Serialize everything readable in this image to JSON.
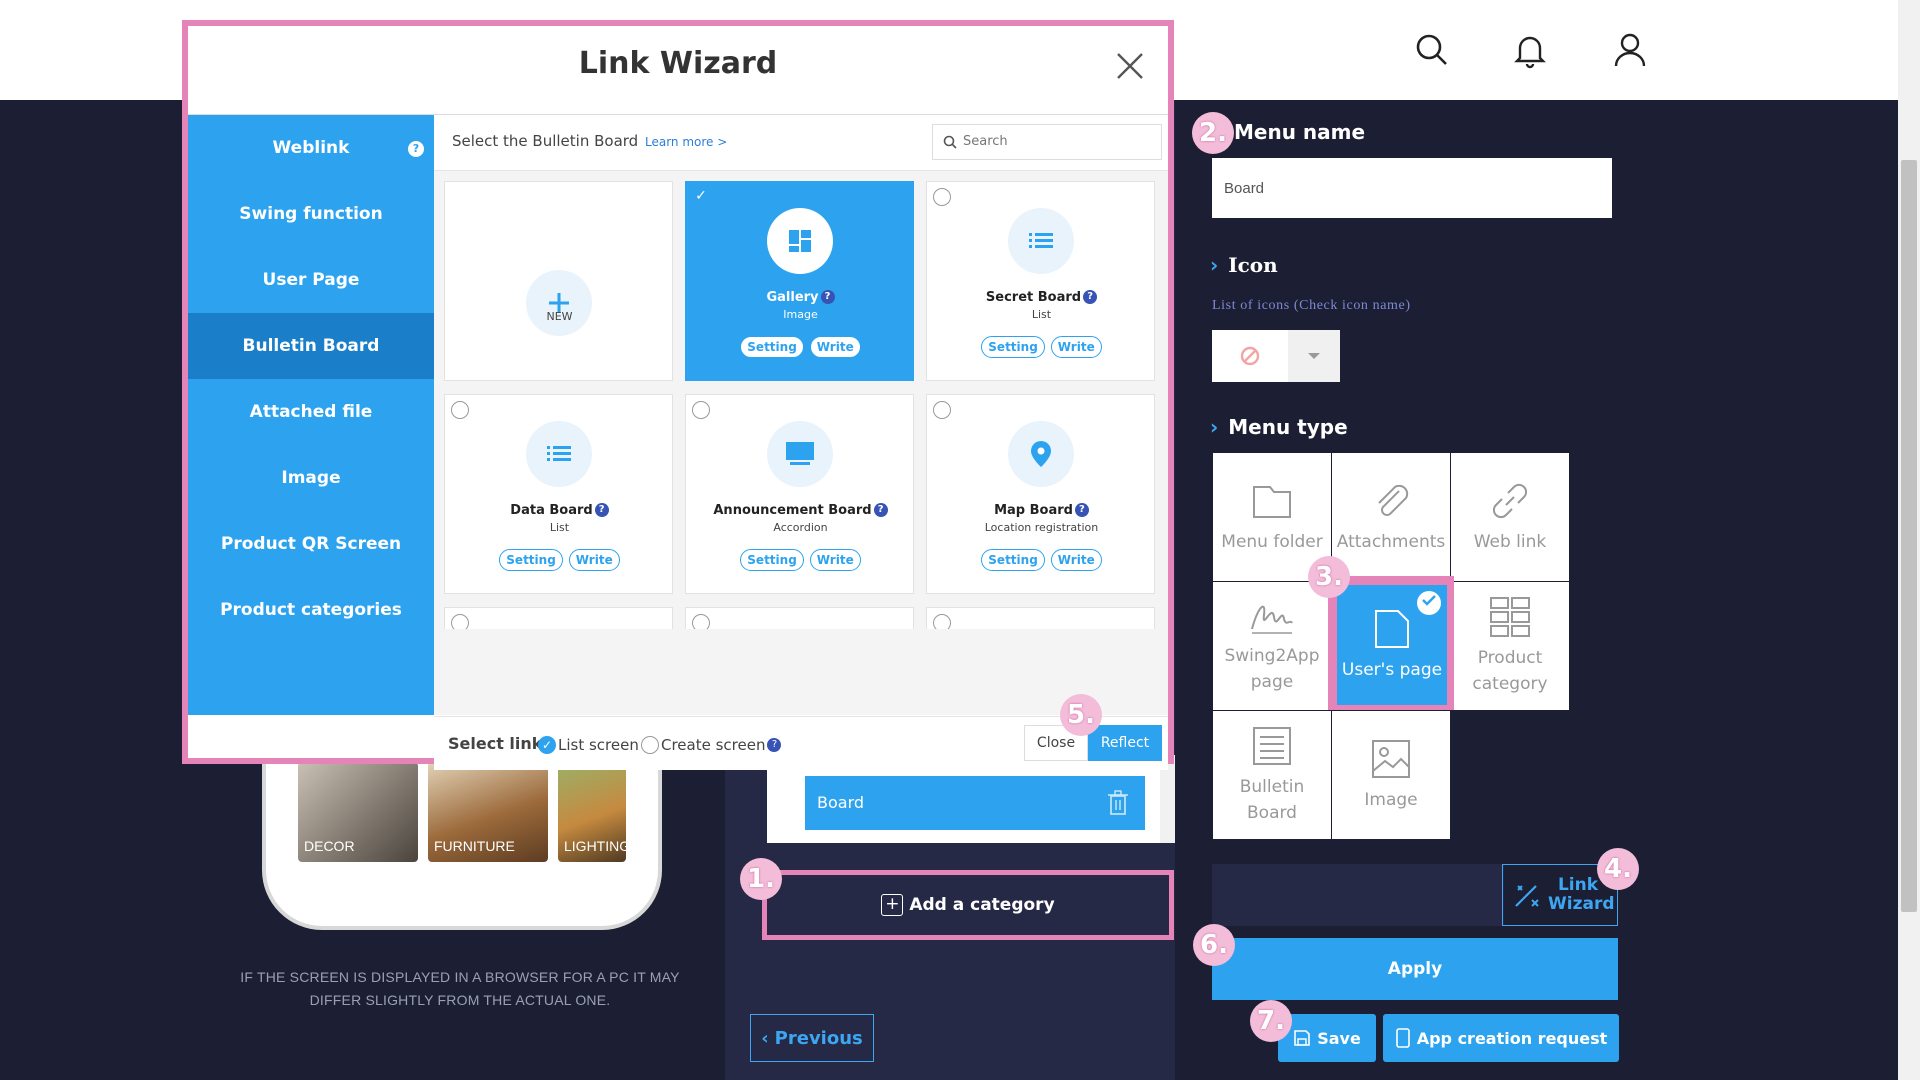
{
  "colors": {
    "accent": "#2da3f0",
    "highlight": "#e584b8",
    "background": "#1c1f33"
  },
  "header": {
    "icons": [
      "search-icon",
      "bell-icon",
      "user-icon"
    ]
  },
  "preview": {
    "thumbnails": [
      "DECOR",
      "FURNITURE",
      "LIGHTING"
    ],
    "note": "IF THE SCREEN IS DISPLAYED IN A BROWSER FOR A PC IT MAY DIFFER SLIGHTLY FROM THE ACTUAL ONE."
  },
  "categories": {
    "row_label": "Board",
    "add_label": "Add a category"
  },
  "nav": {
    "previous": "Previous"
  },
  "settings": {
    "menu_name_label": "Menu name",
    "menu_name_value": "Board",
    "icon_label": "Icon",
    "icon_list_link": "List of icons (Check icon name)",
    "menu_type_label": "Menu type",
    "menu_types": [
      {
        "label": "Menu folder",
        "icon": "folder-icon"
      },
      {
        "label": "Attachments",
        "icon": "paperclip-icon"
      },
      {
        "label": "Web link",
        "icon": "link-icon"
      },
      {
        "label": "Swing2App page",
        "icon": "signature-icon"
      },
      {
        "label": "User's page",
        "icon": "page-icon",
        "selected": true
      },
      {
        "label": "Product category",
        "icon": "grid-icon"
      },
      {
        "label": "Bulletin Board",
        "icon": "list-icon"
      },
      {
        "label": "Image",
        "icon": "image-icon"
      }
    ],
    "link_wizard": "Link Wizard",
    "apply": "Apply",
    "save": "Save",
    "app_request": "App creation request"
  },
  "badges": [
    "1.",
    "2.",
    "3.",
    "4.",
    "5.",
    "6.",
    "7."
  ],
  "modal": {
    "title": "Link Wizard",
    "sidebar": [
      {
        "label": "Weblink",
        "active": false
      },
      {
        "label": "Swing function",
        "active": false
      },
      {
        "label": "User Page",
        "active": false
      },
      {
        "label": "Bulletin Board",
        "active": true
      },
      {
        "label": "Attached file",
        "active": false
      },
      {
        "label": "Image",
        "active": false
      },
      {
        "label": "Product QR Screen",
        "active": false
      },
      {
        "label": "Product categories",
        "active": false
      }
    ],
    "instruction": "Select the Bulletin Board",
    "learn_more": "Learn more >",
    "search_placeholder": "Search",
    "cards": [
      {
        "name": "NEW",
        "sub": "",
        "type": "new"
      },
      {
        "name": "Gallery",
        "sub": "Image",
        "selected": true
      },
      {
        "name": "Secret Board",
        "sub": "List"
      },
      {
        "name": "Data Board",
        "sub": "List"
      },
      {
        "name": "Announcement Board",
        "sub": "Accordion"
      },
      {
        "name": "Map Board",
        "sub": "Location registration"
      }
    ],
    "card_setting": "Setting",
    "card_write": "Write",
    "select_link": "Select link",
    "opt_list": "List screen",
    "opt_create": "Create screen",
    "close": "Close",
    "reflect": "Reflect"
  }
}
